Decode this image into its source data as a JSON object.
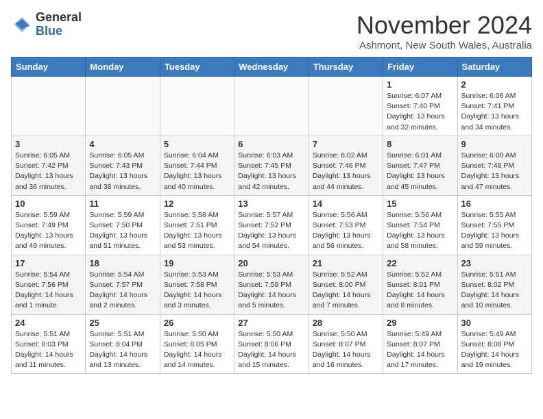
{
  "logo": {
    "general": "General",
    "blue": "Blue"
  },
  "header": {
    "month": "November 2024",
    "location": "Ashmont, New South Wales, Australia"
  },
  "days_of_week": [
    "Sunday",
    "Monday",
    "Tuesday",
    "Wednesday",
    "Thursday",
    "Friday",
    "Saturday"
  ],
  "weeks": [
    [
      {
        "day": "",
        "info": ""
      },
      {
        "day": "",
        "info": ""
      },
      {
        "day": "",
        "info": ""
      },
      {
        "day": "",
        "info": ""
      },
      {
        "day": "",
        "info": ""
      },
      {
        "day": "1",
        "info": "Sunrise: 6:07 AM\nSunset: 7:40 PM\nDaylight: 13 hours\nand 32 minutes."
      },
      {
        "day": "2",
        "info": "Sunrise: 6:06 AM\nSunset: 7:41 PM\nDaylight: 13 hours\nand 34 minutes."
      }
    ],
    [
      {
        "day": "3",
        "info": "Sunrise: 6:05 AM\nSunset: 7:42 PM\nDaylight: 13 hours\nand 36 minutes."
      },
      {
        "day": "4",
        "info": "Sunrise: 6:05 AM\nSunset: 7:43 PM\nDaylight: 13 hours\nand 38 minutes."
      },
      {
        "day": "5",
        "info": "Sunrise: 6:04 AM\nSunset: 7:44 PM\nDaylight: 13 hours\nand 40 minutes."
      },
      {
        "day": "6",
        "info": "Sunrise: 6:03 AM\nSunset: 7:45 PM\nDaylight: 13 hours\nand 42 minutes."
      },
      {
        "day": "7",
        "info": "Sunrise: 6:02 AM\nSunset: 7:46 PM\nDaylight: 13 hours\nand 44 minutes."
      },
      {
        "day": "8",
        "info": "Sunrise: 6:01 AM\nSunset: 7:47 PM\nDaylight: 13 hours\nand 45 minutes."
      },
      {
        "day": "9",
        "info": "Sunrise: 6:00 AM\nSunset: 7:48 PM\nDaylight: 13 hours\nand 47 minutes."
      }
    ],
    [
      {
        "day": "10",
        "info": "Sunrise: 5:59 AM\nSunset: 7:49 PM\nDaylight: 13 hours\nand 49 minutes."
      },
      {
        "day": "11",
        "info": "Sunrise: 5:59 AM\nSunset: 7:50 PM\nDaylight: 13 hours\nand 51 minutes."
      },
      {
        "day": "12",
        "info": "Sunrise: 5:58 AM\nSunset: 7:51 PM\nDaylight: 13 hours\nand 53 minutes."
      },
      {
        "day": "13",
        "info": "Sunrise: 5:57 AM\nSunset: 7:52 PM\nDaylight: 13 hours\nand 54 minutes."
      },
      {
        "day": "14",
        "info": "Sunrise: 5:56 AM\nSunset: 7:53 PM\nDaylight: 13 hours\nand 56 minutes."
      },
      {
        "day": "15",
        "info": "Sunrise: 5:56 AM\nSunset: 7:54 PM\nDaylight: 13 hours\nand 58 minutes."
      },
      {
        "day": "16",
        "info": "Sunrise: 5:55 AM\nSunset: 7:55 PM\nDaylight: 13 hours\nand 59 minutes."
      }
    ],
    [
      {
        "day": "17",
        "info": "Sunrise: 5:54 AM\nSunset: 7:56 PM\nDaylight: 14 hours\nand 1 minute."
      },
      {
        "day": "18",
        "info": "Sunrise: 5:54 AM\nSunset: 7:57 PM\nDaylight: 14 hours\nand 2 minutes."
      },
      {
        "day": "19",
        "info": "Sunrise: 5:53 AM\nSunset: 7:58 PM\nDaylight: 14 hours\nand 3 minutes."
      },
      {
        "day": "20",
        "info": "Sunrise: 5:53 AM\nSunset: 7:59 PM\nDaylight: 14 hours\nand 5 minutes."
      },
      {
        "day": "21",
        "info": "Sunrise: 5:52 AM\nSunset: 8:00 PM\nDaylight: 14 hours\nand 7 minutes."
      },
      {
        "day": "22",
        "info": "Sunrise: 5:52 AM\nSunset: 8:01 PM\nDaylight: 14 hours\nand 8 minutes."
      },
      {
        "day": "23",
        "info": "Sunrise: 5:51 AM\nSunset: 8:02 PM\nDaylight: 14 hours\nand 10 minutes."
      }
    ],
    [
      {
        "day": "24",
        "info": "Sunrise: 5:51 AM\nSunset: 8:03 PM\nDaylight: 14 hours\nand 11 minutes."
      },
      {
        "day": "25",
        "info": "Sunrise: 5:51 AM\nSunset: 8:04 PM\nDaylight: 14 hours\nand 13 minutes."
      },
      {
        "day": "26",
        "info": "Sunrise: 5:50 AM\nSunset: 8:05 PM\nDaylight: 14 hours\nand 14 minutes."
      },
      {
        "day": "27",
        "info": "Sunrise: 5:50 AM\nSunset: 8:06 PM\nDaylight: 14 hours\nand 15 minutes."
      },
      {
        "day": "28",
        "info": "Sunrise: 5:50 AM\nSunset: 8:07 PM\nDaylight: 14 hours\nand 16 minutes."
      },
      {
        "day": "29",
        "info": "Sunrise: 5:49 AM\nSunset: 8:07 PM\nDaylight: 14 hours\nand 17 minutes."
      },
      {
        "day": "30",
        "info": "Sunrise: 5:49 AM\nSunset: 8:08 PM\nDaylight: 14 hours\nand 19 minutes."
      }
    ]
  ]
}
